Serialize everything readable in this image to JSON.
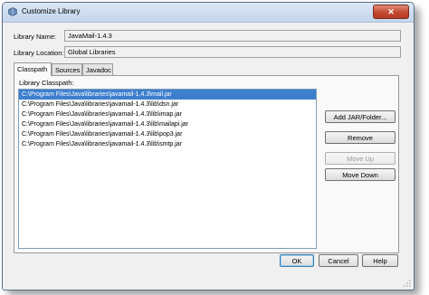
{
  "window": {
    "title": "Customize Library"
  },
  "form": {
    "library_name_label": "Library Name:",
    "library_name_value": "JavaMail-1.4.3",
    "library_location_label": "Library Location:",
    "library_location_value": "Global Libraries"
  },
  "tabs": [
    {
      "label": "Classpath",
      "active": true
    },
    {
      "label": "Sources",
      "active": false
    },
    {
      "label": "Javadoc",
      "active": false
    }
  ],
  "classpath": {
    "label": "Library Classpath:",
    "items": [
      "C:\\Program Files\\Java\\libraries\\javamail-1.4.3\\mail.jar",
      "C:\\Program Files\\Java\\libraries\\javamail-1.4.3\\lib\\dsn.jar",
      "C:\\Program Files\\Java\\libraries\\javamail-1.4.3\\lib\\imap.jar",
      "C:\\Program Files\\Java\\libraries\\javamail-1.4.3\\lib\\mailapi.jar",
      "C:\\Program Files\\Java\\libraries\\javamail-1.4.3\\lib\\pop3.jar",
      "C:\\Program Files\\Java\\libraries\\javamail-1.4.3\\lib\\smtp.jar"
    ],
    "selected_index": 0
  },
  "side_buttons": {
    "add_jar": "Add JAR/Folder...",
    "remove": "Remove",
    "move_up": "Move Up",
    "move_down": "Move Down"
  },
  "footer_buttons": {
    "ok": "OK",
    "cancel": "Cancel",
    "help": "Help"
  },
  "colors": {
    "selection": "#3d7fcd",
    "close_button": "#c24a31"
  }
}
